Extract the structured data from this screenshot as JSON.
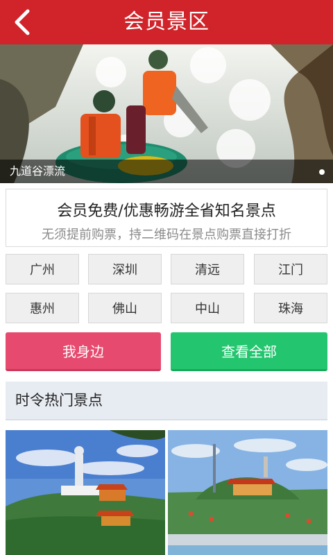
{
  "header": {
    "title": "会员景区",
    "back_icon": "back-arrow-icon"
  },
  "banner": {
    "caption": "九道谷漂流"
  },
  "promo": {
    "title": "会员免费/优惠畅游全省知名景点",
    "subtitle": "无须提前购票，持二维码在景点购票直接打折"
  },
  "cities": [
    "广州",
    "深圳",
    "清远",
    "江门",
    "惠州",
    "佛山",
    "中山",
    "珠海"
  ],
  "actions": {
    "nearby": "我身边",
    "view_all": "查看全部"
  },
  "section": {
    "title": "时令热门景点"
  },
  "colors": {
    "header": "#d0232a",
    "nearby": "#e64a6e",
    "view_all": "#23c66f"
  }
}
